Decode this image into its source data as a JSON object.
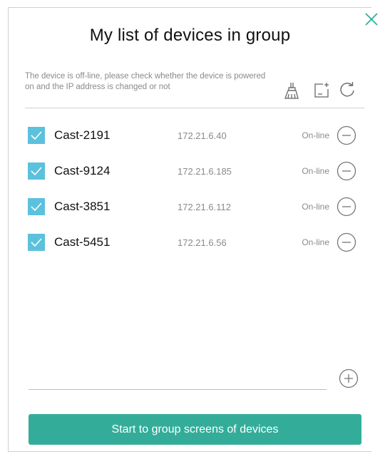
{
  "dialog": {
    "title": "My list of devices in group",
    "notice": "The device is off-line, please check whether the device is powered on and the IP address is changed or not",
    "icons": {
      "close": "close-icon",
      "clean": "broom-icon",
      "add_screen": "add-screen-icon",
      "refresh": "refresh-icon",
      "remove": "minus-circle-icon",
      "add": "plus-circle-icon"
    },
    "devices": [
      {
        "name": "Cast-2191",
        "ip": "172.21.6.40",
        "status": "On-line",
        "checked": true
      },
      {
        "name": "Cast-9124",
        "ip": "172.21.6.185",
        "status": "On-line",
        "checked": true
      },
      {
        "name": "Cast-3851",
        "ip": "172.21.6.112",
        "status": "On-line",
        "checked": true
      },
      {
        "name": "Cast-5451",
        "ip": "172.21.6.56",
        "status": "On-line",
        "checked": true
      }
    ],
    "start_button": "Start to group screens of devices"
  },
  "colors": {
    "accent": "#33ad9a",
    "checkbox": "#5bc1dd",
    "muted_text": "#8a8a8a",
    "icon": "#666666"
  }
}
